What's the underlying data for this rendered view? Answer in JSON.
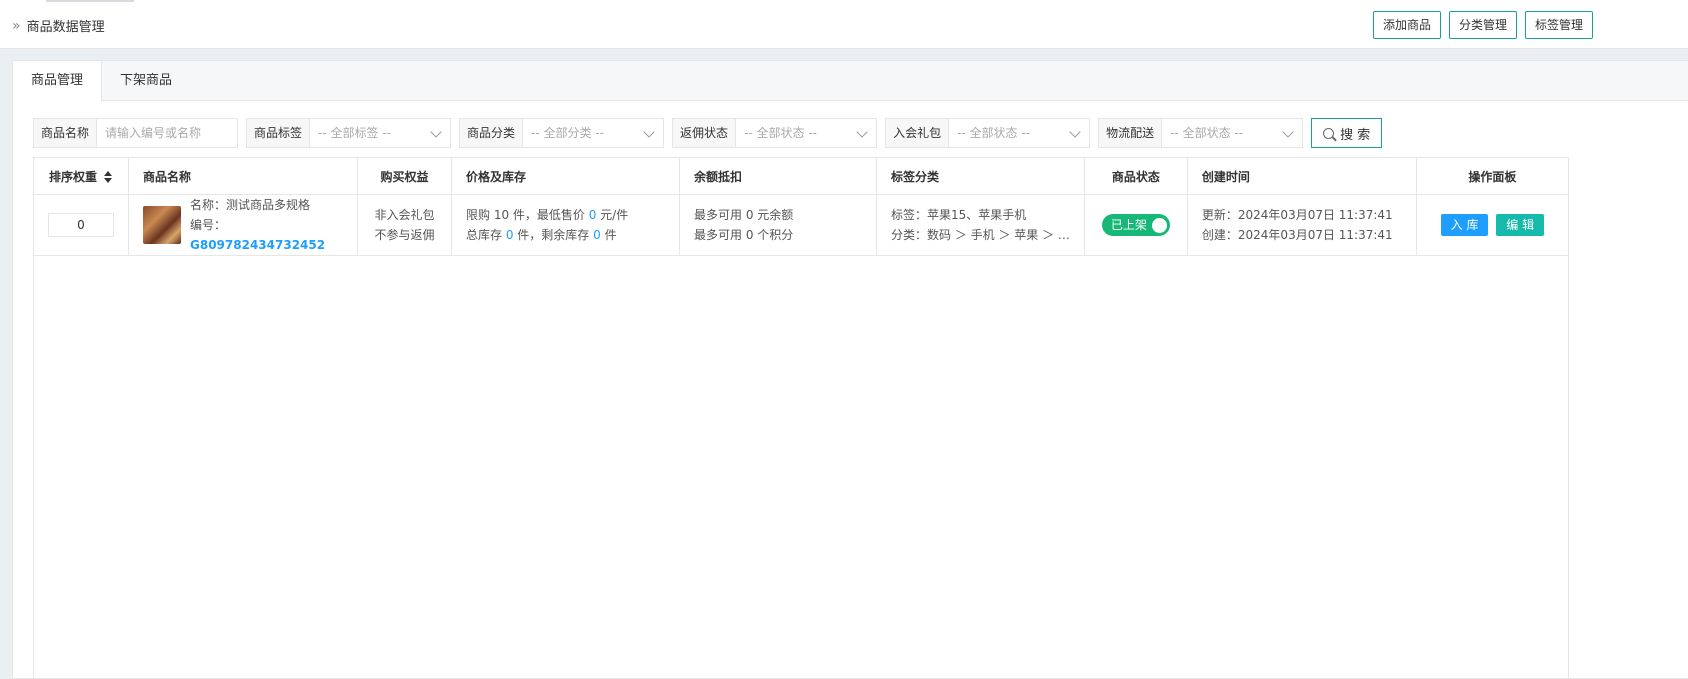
{
  "breadcrumb": {
    "title": "商品数据管理"
  },
  "top_actions": [
    "添加商品",
    "分类管理",
    "标签管理"
  ],
  "tabs": [
    "商品管理",
    "下架商品"
  ],
  "filters": {
    "name": {
      "label": "商品名称",
      "placeholder": "请输入编号或名称"
    },
    "tag": {
      "label": "商品标签",
      "value": "-- 全部标签 --"
    },
    "category": {
      "label": "商品分类",
      "value": "-- 全部分类 --"
    },
    "rebate": {
      "label": "返佣状态",
      "value": "-- 全部状态 --"
    },
    "gift": {
      "label": "入会礼包",
      "value": "-- 全部状态 --"
    },
    "logistics": {
      "label": "物流配送",
      "value": "-- 全部状态 --"
    },
    "search_label": "搜 索"
  },
  "table": {
    "headers": {
      "weight": "排序权重",
      "name": "商品名称",
      "rights": "购买权益",
      "price": "价格及库存",
      "balance": "余额抵扣",
      "tags": "标签分类",
      "status": "商品状态",
      "created": "创建时间",
      "ops": "操作面板"
    },
    "rows": [
      {
        "weight": "0",
        "name_label": "名称：",
        "name": "测试商品多规格",
        "code_label": "编号：",
        "code": "G809782434732452",
        "rights_1": "非入会礼包",
        "rights_2": "不参与返佣",
        "price_1_pre": "限购 10 件，最低售价 ",
        "price_1_val": "0",
        "price_1_post": " 元/件",
        "price_2_pre": "总库存 ",
        "price_2_val": "0",
        "price_2_mid": " 件，剩余库存 ",
        "price_2_val2": "0",
        "price_2_post": " 件",
        "balance_1": "最多可用 0 元余额",
        "balance_2": "最多可用 0 个积分",
        "tags_1": "标签：苹果15、苹果手机",
        "tags_2": "分类：数码 ＞ 手机 ＞ 苹果 ＞ …",
        "status": "已上架",
        "updated": "更新：2024年03月07日 11:37:41",
        "created": "创建：2024年03月07日 11:37:41",
        "op_in": "入 库",
        "op_edit": "编 辑"
      }
    ]
  }
}
